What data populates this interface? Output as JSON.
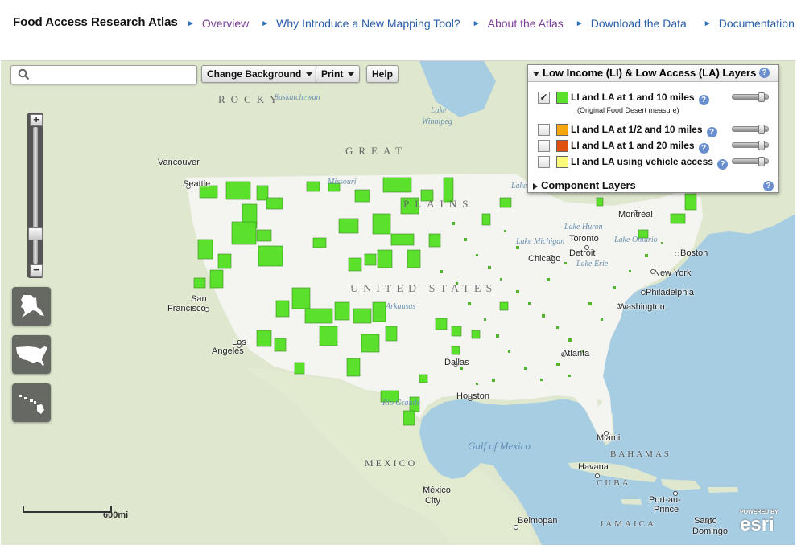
{
  "header": {
    "brand": "Food Access Research Atlas",
    "nav": [
      {
        "label": "Overview"
      },
      {
        "label": "Why Introduce a New Mapping Tool?"
      },
      {
        "label": "About the Atlas"
      },
      {
        "label": "Download the Data"
      },
      {
        "label": "Documentation"
      }
    ]
  },
  "toolbar": {
    "search_value": "",
    "change_background": "Change Background",
    "print": "Print",
    "help": "Help"
  },
  "zoom": {
    "plus": "+",
    "minus": "−",
    "level": 0.25
  },
  "layers_panel": {
    "title": "Low Income (LI) & Low Access (LA) Layers",
    "help": "?",
    "layers": [
      {
        "label": "LI and LA at 1 and 10 miles",
        "checked": true,
        "check_mark": "✓",
        "color": "#5be02c",
        "note": "(Original Food Desert measure)",
        "help": "?",
        "opacity": 0.9
      },
      {
        "label": "LI and LA at 1/2 and 10 miles",
        "checked": false,
        "check_mark": "",
        "color": "#f5a60e",
        "help": "?",
        "opacity": 0.9
      },
      {
        "label": "LI and LA at 1 and 20 miles",
        "checked": false,
        "check_mark": "",
        "color": "#e0500f",
        "help": "?",
        "opacity": 0.9
      },
      {
        "label": "LI and LA using vehicle access",
        "checked": false,
        "check_mark": "",
        "color": "#fbf97a",
        "help": "?",
        "opacity": 0.9
      }
    ],
    "component_layers": "Component Layers"
  },
  "map_labels": {
    "vancouver": "Vancouver",
    "seattle": "Seattle",
    "san": "San",
    "francisco": "Francisco",
    "los": "Los",
    "angeles": "Angeles",
    "dallas": "Dallas",
    "houston": "Houston",
    "atlanta": "Atlanta",
    "miami": "Miami",
    "chicago": "Chicago",
    "detroit": "Detroit",
    "toronto": "Toronto",
    "montreal": "Montréal",
    "boston": "Boston",
    "new_york": "New York",
    "philadelphia": "Philadelphia",
    "washington": "Washington",
    "havana": "Havana",
    "mexico_city_1": "México",
    "mexico_city_2": "City",
    "belmopan": "Belmopan",
    "port_au_prince_1": "Port-au-",
    "port_au_prince_2": "Prince",
    "santo": "Santo",
    "domingo": "Domingo",
    "united_states": "UNITED STATES",
    "mexico": "MEXICO",
    "bahamas": "BAHAMAS",
    "cuba": "CUBA",
    "jamaica": "JAMAICA",
    "gulf": "Gulf of Mexico",
    "great": "GREAT",
    "plains": "PLAINS",
    "rocky": "ROCKY",
    "lake_winnipeg_1": "Lake",
    "lake_winnipeg_2": "Winnipeg",
    "saskatchewan": "Saskatchewan",
    "missouri": "Missouri",
    "arkansas": "Arkansas",
    "lake_superior": "Lake Superior",
    "lake_huron": "Lake Huron",
    "lake_michigan": "Lake Michigan",
    "lake_erie": "Lake Erie",
    "lake_ontario": "Lake Ontario",
    "rio_grande": "Rio Grande"
  },
  "scale": {
    "label": "600mi"
  },
  "attribution": {
    "powered": "POWERED BY",
    "name": "esri"
  },
  "colors": {
    "food_desert": "#5be02c",
    "water": "#a7cde3",
    "land": "#dfe8cf",
    "us_land": "#f4f4f1"
  }
}
